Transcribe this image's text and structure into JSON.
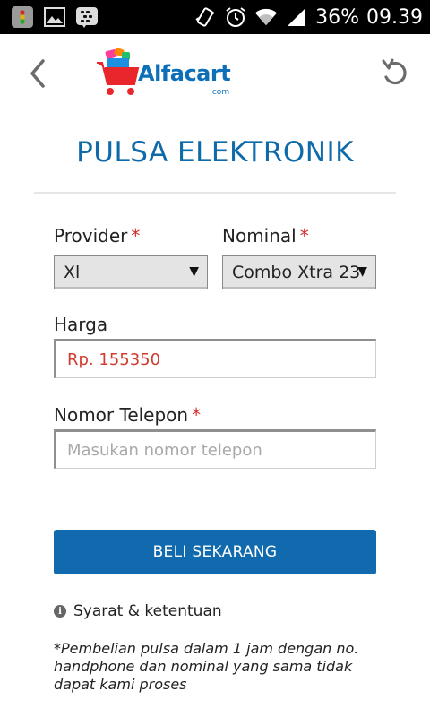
{
  "status_bar": {
    "battery_percent": "36%",
    "time": "09.39",
    "icons": [
      "app-notification-icon",
      "image-icon",
      "bbm-icon",
      "vibrate-icon",
      "alarm-icon",
      "wifi-icon",
      "signal-icon"
    ]
  },
  "header": {
    "logo_text": "Alfacart",
    "logo_sub": ".com"
  },
  "page": {
    "title": "PULSA ELEKTRONIK"
  },
  "form": {
    "provider": {
      "label": "Provider",
      "required_mark": "*",
      "value": "Xl"
    },
    "nominal": {
      "label": "Nominal",
      "required_mark": "*",
      "value": "Combo Xtra 23"
    },
    "price": {
      "label": "Harga",
      "value": "Rp. 155350"
    },
    "phone": {
      "label": "Nomor Telepon",
      "required_mark": "*",
      "placeholder": "Masukan nomor telepon"
    },
    "buy_label": "BELI SEKARANG"
  },
  "terms": {
    "label": "Syarat & ketentuan",
    "note": "*Pembelian pulsa dalam 1 jam dengan no. handphone dan nominal yang sama tidak dapat kami proses"
  },
  "colors": {
    "accent": "#106aad",
    "title": "#0e6aa8",
    "required": "#d62b2b",
    "price_text": "#d13a2e"
  }
}
